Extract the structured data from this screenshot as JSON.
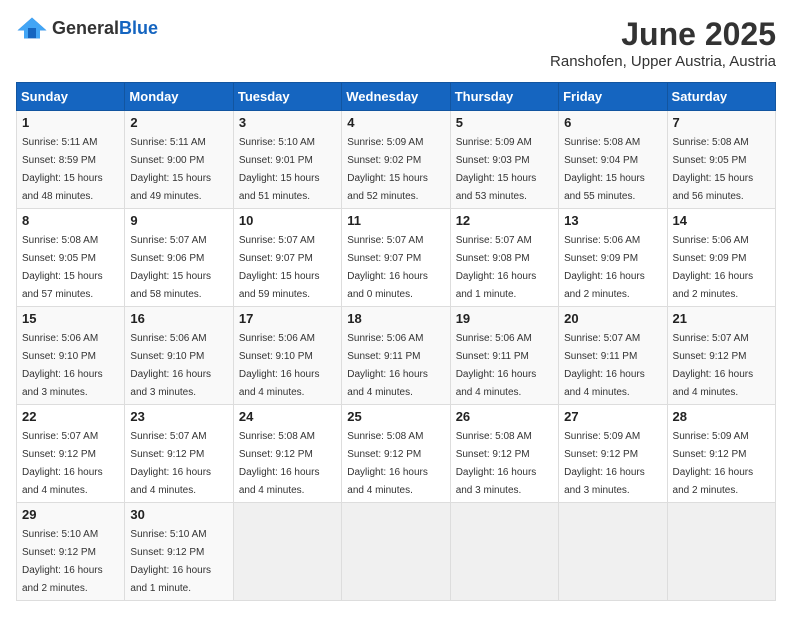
{
  "header": {
    "logo_general": "General",
    "logo_blue": "Blue",
    "month_year": "June 2025",
    "location": "Ranshofen, Upper Austria, Austria"
  },
  "weekdays": [
    "Sunday",
    "Monday",
    "Tuesday",
    "Wednesday",
    "Thursday",
    "Friday",
    "Saturday"
  ],
  "weeks": [
    [
      {
        "day": "1",
        "sunrise": "5:11 AM",
        "sunset": "8:59 PM",
        "daylight": "15 hours and 48 minutes."
      },
      {
        "day": "2",
        "sunrise": "5:11 AM",
        "sunset": "9:00 PM",
        "daylight": "15 hours and 49 minutes."
      },
      {
        "day": "3",
        "sunrise": "5:10 AM",
        "sunset": "9:01 PM",
        "daylight": "15 hours and 51 minutes."
      },
      {
        "day": "4",
        "sunrise": "5:09 AM",
        "sunset": "9:02 PM",
        "daylight": "15 hours and 52 minutes."
      },
      {
        "day": "5",
        "sunrise": "5:09 AM",
        "sunset": "9:03 PM",
        "daylight": "15 hours and 53 minutes."
      },
      {
        "day": "6",
        "sunrise": "5:08 AM",
        "sunset": "9:04 PM",
        "daylight": "15 hours and 55 minutes."
      },
      {
        "day": "7",
        "sunrise": "5:08 AM",
        "sunset": "9:05 PM",
        "daylight": "15 hours and 56 minutes."
      }
    ],
    [
      {
        "day": "8",
        "sunrise": "5:08 AM",
        "sunset": "9:05 PM",
        "daylight": "15 hours and 57 minutes."
      },
      {
        "day": "9",
        "sunrise": "5:07 AM",
        "sunset": "9:06 PM",
        "daylight": "15 hours and 58 minutes."
      },
      {
        "day": "10",
        "sunrise": "5:07 AM",
        "sunset": "9:07 PM",
        "daylight": "15 hours and 59 minutes."
      },
      {
        "day": "11",
        "sunrise": "5:07 AM",
        "sunset": "9:07 PM",
        "daylight": "16 hours and 0 minutes."
      },
      {
        "day": "12",
        "sunrise": "5:07 AM",
        "sunset": "9:08 PM",
        "daylight": "16 hours and 1 minute."
      },
      {
        "day": "13",
        "sunrise": "5:06 AM",
        "sunset": "9:09 PM",
        "daylight": "16 hours and 2 minutes."
      },
      {
        "day": "14",
        "sunrise": "5:06 AM",
        "sunset": "9:09 PM",
        "daylight": "16 hours and 2 minutes."
      }
    ],
    [
      {
        "day": "15",
        "sunrise": "5:06 AM",
        "sunset": "9:10 PM",
        "daylight": "16 hours and 3 minutes."
      },
      {
        "day": "16",
        "sunrise": "5:06 AM",
        "sunset": "9:10 PM",
        "daylight": "16 hours and 3 minutes."
      },
      {
        "day": "17",
        "sunrise": "5:06 AM",
        "sunset": "9:10 PM",
        "daylight": "16 hours and 4 minutes."
      },
      {
        "day": "18",
        "sunrise": "5:06 AM",
        "sunset": "9:11 PM",
        "daylight": "16 hours and 4 minutes."
      },
      {
        "day": "19",
        "sunrise": "5:06 AM",
        "sunset": "9:11 PM",
        "daylight": "16 hours and 4 minutes."
      },
      {
        "day": "20",
        "sunrise": "5:07 AM",
        "sunset": "9:11 PM",
        "daylight": "16 hours and 4 minutes."
      },
      {
        "day": "21",
        "sunrise": "5:07 AM",
        "sunset": "9:12 PM",
        "daylight": "16 hours and 4 minutes."
      }
    ],
    [
      {
        "day": "22",
        "sunrise": "5:07 AM",
        "sunset": "9:12 PM",
        "daylight": "16 hours and 4 minutes."
      },
      {
        "day": "23",
        "sunrise": "5:07 AM",
        "sunset": "9:12 PM",
        "daylight": "16 hours and 4 minutes."
      },
      {
        "day": "24",
        "sunrise": "5:08 AM",
        "sunset": "9:12 PM",
        "daylight": "16 hours and 4 minutes."
      },
      {
        "day": "25",
        "sunrise": "5:08 AM",
        "sunset": "9:12 PM",
        "daylight": "16 hours and 4 minutes."
      },
      {
        "day": "26",
        "sunrise": "5:08 AM",
        "sunset": "9:12 PM",
        "daylight": "16 hours and 3 minutes."
      },
      {
        "day": "27",
        "sunrise": "5:09 AM",
        "sunset": "9:12 PM",
        "daylight": "16 hours and 3 minutes."
      },
      {
        "day": "28",
        "sunrise": "5:09 AM",
        "sunset": "9:12 PM",
        "daylight": "16 hours and 2 minutes."
      }
    ],
    [
      {
        "day": "29",
        "sunrise": "5:10 AM",
        "sunset": "9:12 PM",
        "daylight": "16 hours and 2 minutes."
      },
      {
        "day": "30",
        "sunrise": "5:10 AM",
        "sunset": "9:12 PM",
        "daylight": "16 hours and 1 minute."
      },
      null,
      null,
      null,
      null,
      null
    ]
  ]
}
